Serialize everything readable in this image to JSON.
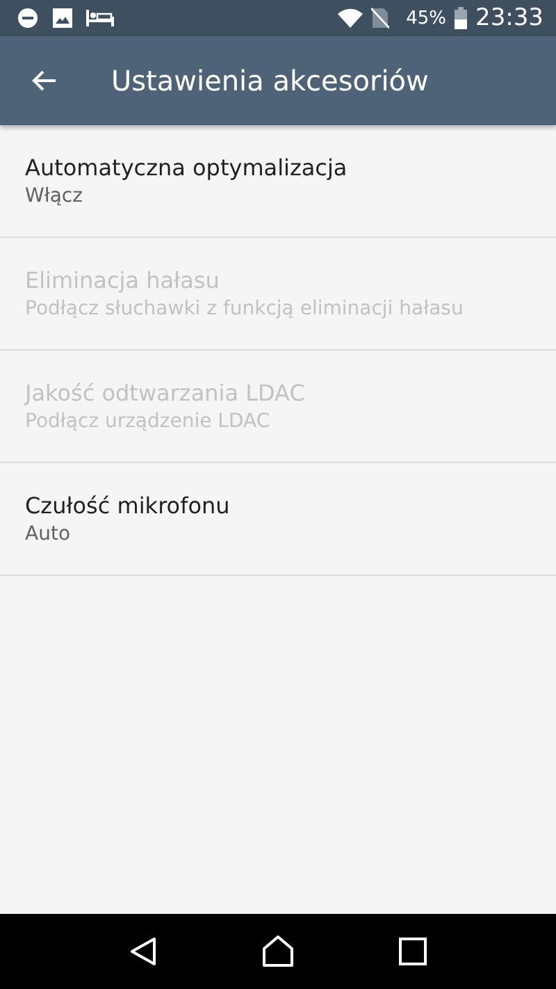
{
  "status_bar": {
    "battery": "45%",
    "time": "23:33"
  },
  "app_bar": {
    "title": "Ustawienia akcesoriów"
  },
  "settings": [
    {
      "title": "Automatyczna optymalizacja",
      "summary": "Włącz",
      "disabled": false
    },
    {
      "title": "Eliminacja hałasu",
      "summary": "Podłącz słuchawki z funkcją eliminacji hałasu",
      "disabled": true
    },
    {
      "title": "Jakość odtwarzania LDAC",
      "summary": "Podłącz urządzenie LDAC",
      "disabled": true
    },
    {
      "title": "Czułość mikrofonu",
      "summary": "Auto",
      "disabled": false
    }
  ]
}
